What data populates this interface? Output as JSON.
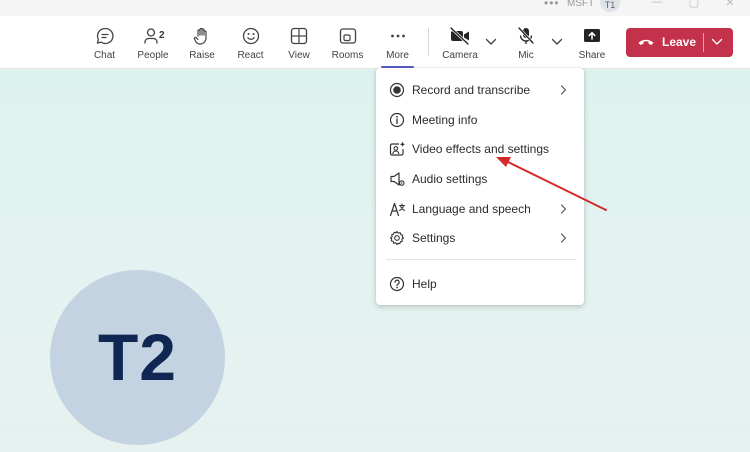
{
  "titlebar": {
    "org": "MSFT",
    "initials": "T1"
  },
  "toolbar": {
    "chat": "Chat",
    "people": "People",
    "people_count": "2",
    "raise": "Raise",
    "react": "React",
    "view": "View",
    "rooms": "Rooms",
    "more": "More",
    "camera": "Camera",
    "mic": "Mic",
    "share": "Share",
    "leave": "Leave"
  },
  "menu": {
    "items": [
      {
        "label": "Record and transcribe",
        "icon": "record-icon",
        "submenu": true
      },
      {
        "label": "Meeting info",
        "icon": "info-icon",
        "submenu": false
      },
      {
        "label": "Video effects and settings",
        "icon": "video-effects-icon",
        "submenu": false
      },
      {
        "label": "Audio settings",
        "icon": "speaker-icon",
        "submenu": false
      },
      {
        "label": "Language and speech",
        "icon": "language-icon",
        "submenu": true
      },
      {
        "label": "Settings",
        "icon": "gear-icon",
        "submenu": true
      },
      {
        "label": "Help",
        "icon": "help-icon",
        "submenu": false
      }
    ]
  },
  "participant": {
    "initials": "T2"
  },
  "colors": {
    "leave": "#c4314b",
    "accent": "#5b5fc7",
    "annotation_arrow": "#d42a2a",
    "avatar_bg": "#c4d3e2",
    "avatar_text": "#0f2752"
  }
}
